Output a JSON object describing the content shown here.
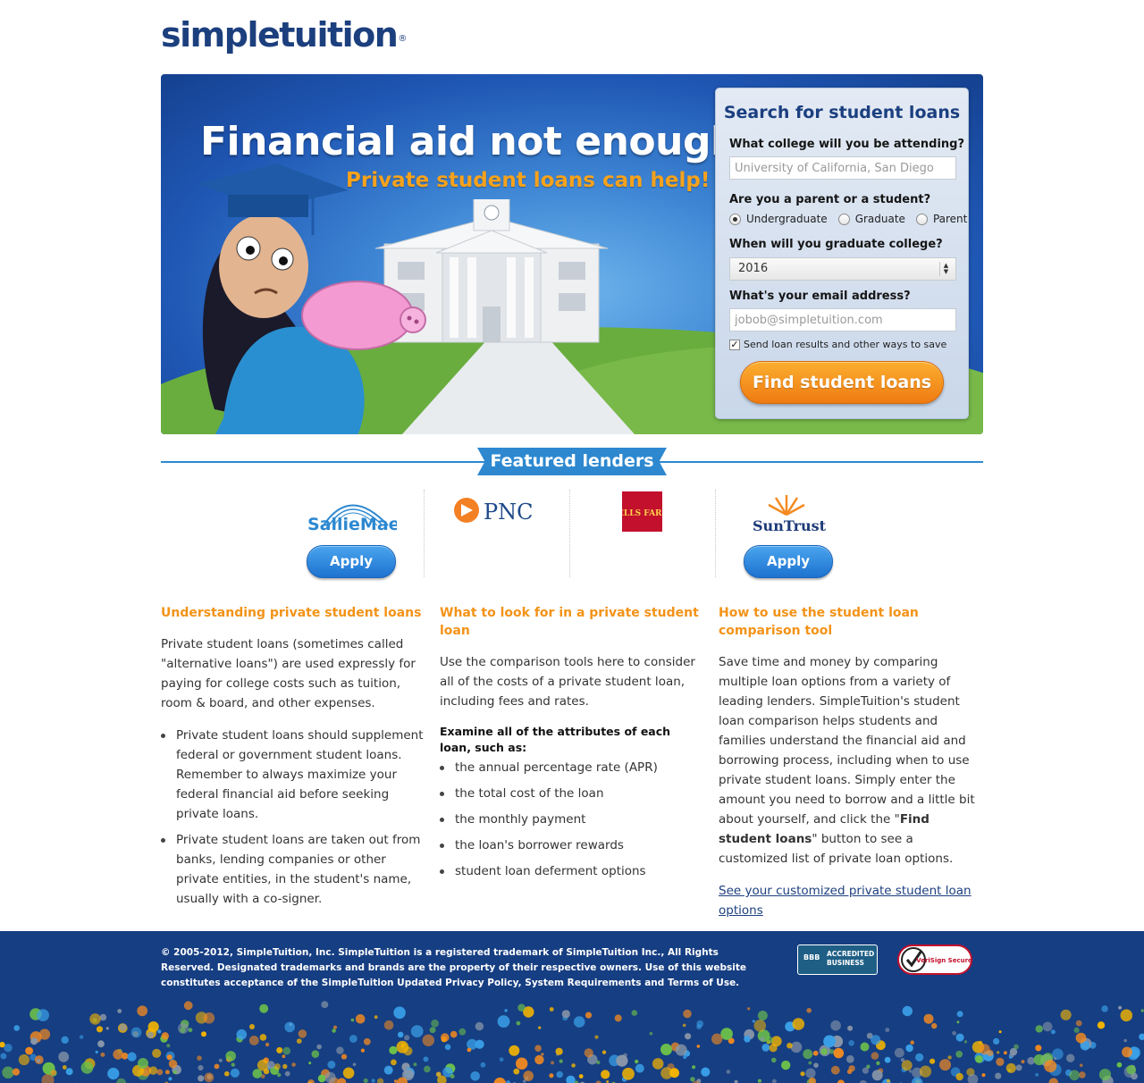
{
  "brand": {
    "logo_text": "simpletuition",
    "reg_mark": "®"
  },
  "hero": {
    "headline": "Financial aid not enough?",
    "subheadline": "Private student loans can help!"
  },
  "search": {
    "title": "Search for student loans",
    "college_label": "What college will you be attending?",
    "college_placeholder": "University of California, San Diego",
    "role_label": "Are you a parent or a student?",
    "roles": [
      "Undergraduate",
      "Graduate",
      "Parent"
    ],
    "role_selected": "Undergraduate",
    "grad_label": "When will you graduate college?",
    "grad_year": "2016",
    "email_label": "What's your email address?",
    "email_placeholder": "jobob@simpletuition.com",
    "optin_label": "Send loan results and other ways to save",
    "optin_checked": true,
    "submit_label": "Find student loans"
  },
  "featured": {
    "title": "Featured lenders",
    "lenders": [
      {
        "name": "SallieMae",
        "apply_label": "Apply"
      },
      {
        "name": "PNC"
      },
      {
        "name": "WELLS FARGO"
      },
      {
        "name": "SunTrust",
        "apply_label": "Apply"
      }
    ]
  },
  "info": {
    "col1": {
      "heading": "Understanding private student loans",
      "intro": "Private student loans (sometimes called \"alternative loans\") are used expressly for paying for college costs such as tuition, room & board, and other expenses.",
      "bullets": [
        "Private student loans should supplement federal or government student loans. Remember to always maximize your federal financial aid before seeking private loans.",
        "Private student loans are taken out from banks, lending companies or other private entities, in the student's name, usually with a co-signer."
      ]
    },
    "col2": {
      "heading": "What to look for in a private student loan",
      "intro": "Use the comparison tools here to consider all of the costs of a private student loan, including fees and rates.",
      "subhead": "Examine all of the attributes of each loan, such as:",
      "bullets": [
        "the annual percentage rate (APR)",
        "the total cost of the loan",
        "the monthly payment",
        "the loan's borrower rewards",
        "student loan deferment options"
      ]
    },
    "col3": {
      "heading": "How to use the student loan comparison tool",
      "body_pre": "Save time and money by comparing multiple loan options from a variety of leading lenders. SimpleTuition's student loan comparison helps students and families understand the financial aid and borrowing process, including when to use private student loans. Simply enter the amount you need to borrow and a little bit about yourself, and click the \"",
      "body_bold": "Find student loans",
      "body_post": "\" button to see a customized list of private loan options.",
      "link": "See your customized private student loan options"
    }
  },
  "footer": {
    "legal": "© 2005-2012, SimpleTuition, Inc. SimpleTuition is a registered trademark of SimpleTuition Inc., All Rights Reserved. Designated trademarks and brands are the property of their respective owners. Use of this website constitutes acceptance of the SimpleTuition Updated Privacy Policy, System Requirements and Terms of Use.",
    "bbb_label": "ACCREDITED BUSINESS",
    "bbb_mark": "BBB",
    "verisign_label": "VeriSign Secured"
  },
  "colors": {
    "brand_navy": "#1c3f7e",
    "accent_orange": "#f39318",
    "link_blue": "#2d88d0",
    "footer_bg": "#163e82"
  }
}
